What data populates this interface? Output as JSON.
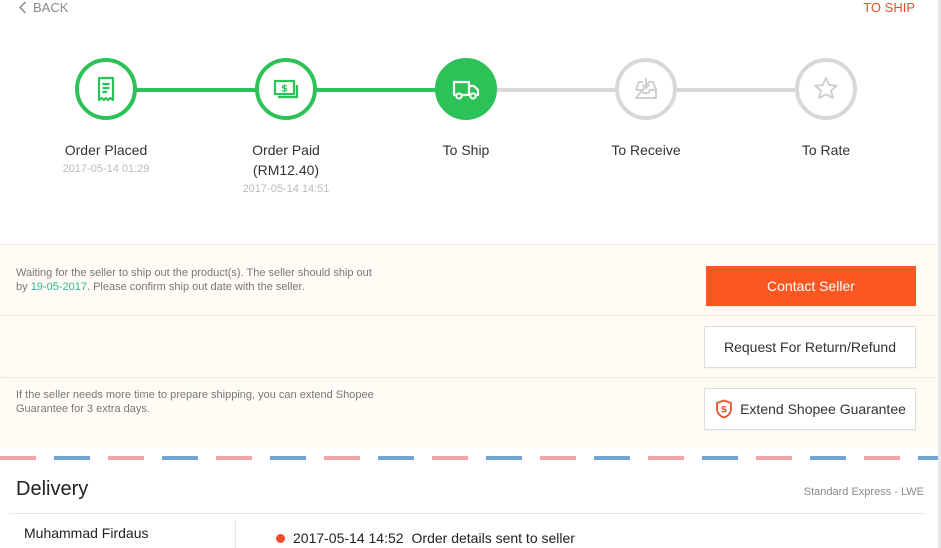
{
  "header": {
    "back_label": "BACK",
    "status_label": "TO SHIP"
  },
  "stepper": {
    "steps": [
      {
        "label": "Order Placed",
        "sub": "",
        "time": "2017-05-14 01:29",
        "state": "done",
        "icon": "receipt-icon"
      },
      {
        "label": "Order Paid",
        "sub": "(RM12.40)",
        "time": "2017-05-14 14:51",
        "state": "done",
        "icon": "money-icon"
      },
      {
        "label": "To Ship",
        "sub": "",
        "time": "",
        "state": "current",
        "icon": "truck-icon"
      },
      {
        "label": "To Receive",
        "sub": "",
        "time": "",
        "state": "pending",
        "icon": "inbox-download-icon"
      },
      {
        "label": "To Rate",
        "sub": "",
        "time": "",
        "state": "pending",
        "icon": "star-icon"
      }
    ]
  },
  "notice": {
    "ship_msg_part1": "Waiting for the seller to ship out the product(s). The seller should ship out",
    "ship_msg_by": "by ",
    "ship_msg_date": "19-05-2017",
    "ship_msg_part2": ". Please confirm ship out date with the seller.",
    "contact_label": "Contact Seller",
    "refund_label": "Request For Return/Refund",
    "extend_msg": "If the seller needs more time to prepare shipping, you can extend Shopee Guarantee for 3 extra days.",
    "extend_label": "Extend Shopee Guarantee"
  },
  "delivery": {
    "title": "Delivery",
    "method": "Standard Express - LWE",
    "recipient": "Muhammad Firdaus",
    "timeline": [
      {
        "time": "2017-05-14 14:52",
        "text": "Order details sent to seller"
      }
    ]
  },
  "colors": {
    "accent": "#ee4d2d",
    "success": "#2dc258",
    "pending": "#d8d8d8"
  }
}
